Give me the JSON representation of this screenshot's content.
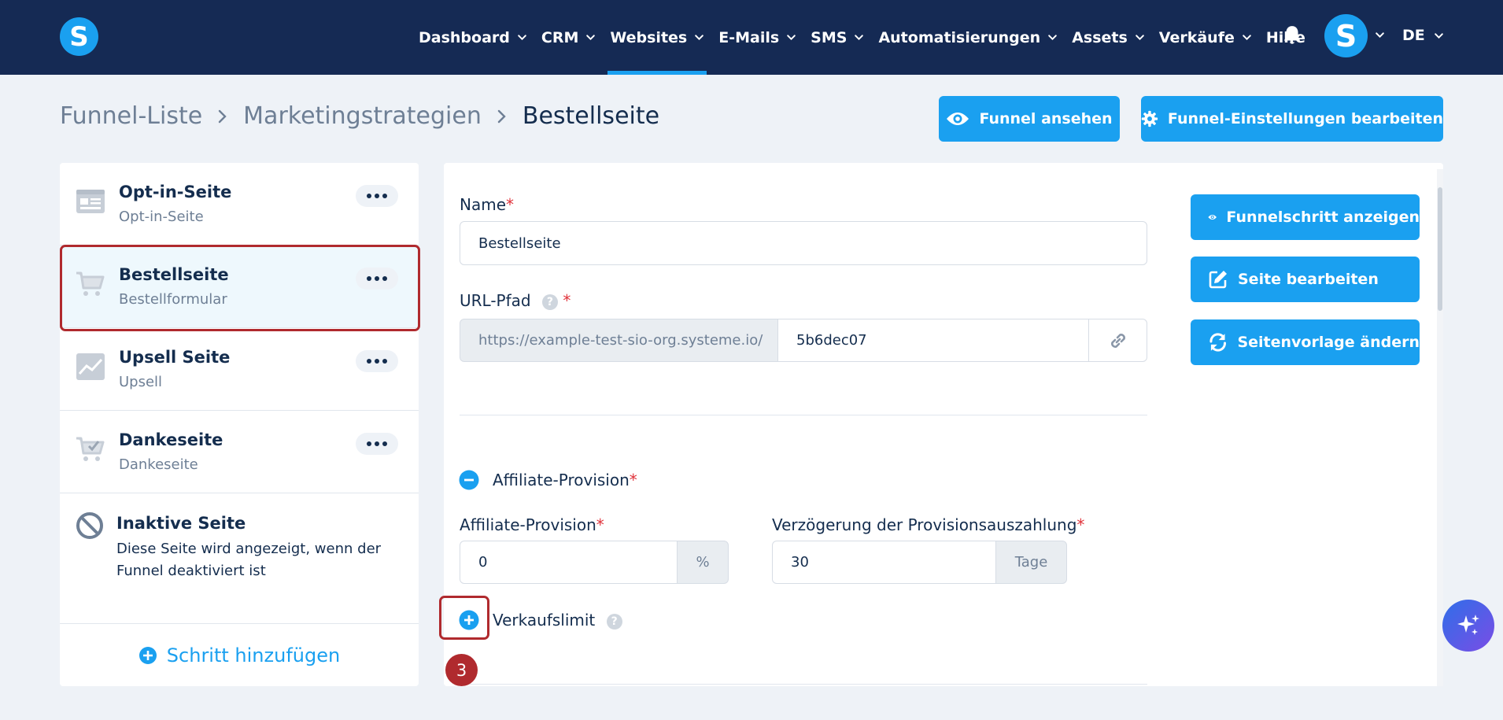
{
  "colors": {
    "nav_bg": "#152a54",
    "accent": "#1aa0f0",
    "annotation": "#b02a2e",
    "page_bg": "#eef2f7"
  },
  "topnav": {
    "logo_letter": "S",
    "items": [
      {
        "label": "Dashboard",
        "active": false
      },
      {
        "label": "CRM",
        "active": false
      },
      {
        "label": "Websites",
        "active": true
      },
      {
        "label": "E-Mails",
        "active": false
      },
      {
        "label": "SMS",
        "active": false
      },
      {
        "label": "Automatisierungen",
        "active": false
      },
      {
        "label": "Assets",
        "active": false
      },
      {
        "label": "Verkäufe",
        "active": false
      }
    ],
    "help_label": "Hilfe",
    "bell_icon": "bell-icon",
    "avatar_letter": "S",
    "language": "DE"
  },
  "breadcrumb": {
    "items": [
      "Funnel-Liste",
      "Marketingstrategien"
    ],
    "current": "Bestellseite"
  },
  "header_buttons": {
    "view_funnel": "Funnel ansehen",
    "edit_settings": "Funnel-Einstellungen bearbeiten"
  },
  "steps": [
    {
      "title": "Opt-in-Seite",
      "subtitle": "Opt-in-Seite",
      "icon": "optin-form-icon",
      "selected": false
    },
    {
      "title": "Bestellseite",
      "subtitle": "Bestellformular",
      "icon": "cart-icon",
      "selected": true
    },
    {
      "title": "Upsell Seite",
      "subtitle": "Upsell",
      "icon": "chart-up-icon",
      "selected": false
    },
    {
      "title": "Dankeseite",
      "subtitle": "Dankeseite",
      "icon": "cart-check-icon",
      "selected": false
    }
  ],
  "inactive_page": {
    "title": "Inaktive Seite",
    "description": "Diese Seite wird angezeigt, wenn der Funnel deaktiviert ist"
  },
  "add_step_label": "Schritt hinzufügen",
  "form": {
    "name_label": "Name",
    "name_value": "Bestellseite",
    "url_label": "URL-Pfad",
    "url_help": "?",
    "url_prefix": "https://example-test-sio-org.systeme.io/",
    "url_slug": "5b6dec07",
    "affiliate_section_label": "Affiliate-Provision",
    "affiliate_label": "Affiliate-Provision",
    "affiliate_value": "0",
    "affiliate_unit": "%",
    "delay_label": "Verzögerung der Provisionsauszahlung",
    "delay_value": "30",
    "delay_unit": "Tage",
    "sales_limit_label": "Verkaufslimit",
    "sales_limit_help": "?"
  },
  "side_buttons": {
    "show_step": "Funnelschritt anzeigen",
    "edit_page": "Seite bearbeiten",
    "change_template": "Seitenvorlage ändern"
  },
  "annotation_number": "3"
}
